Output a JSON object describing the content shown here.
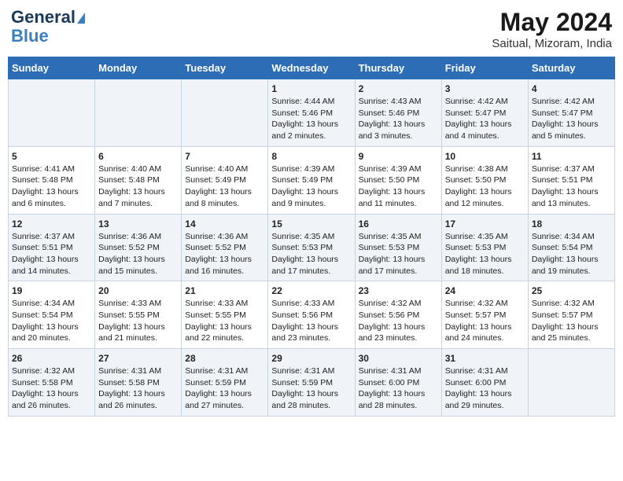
{
  "logo": {
    "line1": "General",
    "line2": "Blue"
  },
  "title": "May 2024",
  "subtitle": "Saitual, Mizoram, India",
  "days_of_week": [
    "Sunday",
    "Monday",
    "Tuesday",
    "Wednesday",
    "Thursday",
    "Friday",
    "Saturday"
  ],
  "weeks": [
    [
      {
        "num": "",
        "detail": ""
      },
      {
        "num": "",
        "detail": ""
      },
      {
        "num": "",
        "detail": ""
      },
      {
        "num": "1",
        "detail": "Sunrise: 4:44 AM\nSunset: 5:46 PM\nDaylight: 13 hours\nand 2 minutes."
      },
      {
        "num": "2",
        "detail": "Sunrise: 4:43 AM\nSunset: 5:46 PM\nDaylight: 13 hours\nand 3 minutes."
      },
      {
        "num": "3",
        "detail": "Sunrise: 4:42 AM\nSunset: 5:47 PM\nDaylight: 13 hours\nand 4 minutes."
      },
      {
        "num": "4",
        "detail": "Sunrise: 4:42 AM\nSunset: 5:47 PM\nDaylight: 13 hours\nand 5 minutes."
      }
    ],
    [
      {
        "num": "5",
        "detail": "Sunrise: 4:41 AM\nSunset: 5:48 PM\nDaylight: 13 hours\nand 6 minutes."
      },
      {
        "num": "6",
        "detail": "Sunrise: 4:40 AM\nSunset: 5:48 PM\nDaylight: 13 hours\nand 7 minutes."
      },
      {
        "num": "7",
        "detail": "Sunrise: 4:40 AM\nSunset: 5:49 PM\nDaylight: 13 hours\nand 8 minutes."
      },
      {
        "num": "8",
        "detail": "Sunrise: 4:39 AM\nSunset: 5:49 PM\nDaylight: 13 hours\nand 9 minutes."
      },
      {
        "num": "9",
        "detail": "Sunrise: 4:39 AM\nSunset: 5:50 PM\nDaylight: 13 hours\nand 11 minutes."
      },
      {
        "num": "10",
        "detail": "Sunrise: 4:38 AM\nSunset: 5:50 PM\nDaylight: 13 hours\nand 12 minutes."
      },
      {
        "num": "11",
        "detail": "Sunrise: 4:37 AM\nSunset: 5:51 PM\nDaylight: 13 hours\nand 13 minutes."
      }
    ],
    [
      {
        "num": "12",
        "detail": "Sunrise: 4:37 AM\nSunset: 5:51 PM\nDaylight: 13 hours\nand 14 minutes."
      },
      {
        "num": "13",
        "detail": "Sunrise: 4:36 AM\nSunset: 5:52 PM\nDaylight: 13 hours\nand 15 minutes."
      },
      {
        "num": "14",
        "detail": "Sunrise: 4:36 AM\nSunset: 5:52 PM\nDaylight: 13 hours\nand 16 minutes."
      },
      {
        "num": "15",
        "detail": "Sunrise: 4:35 AM\nSunset: 5:53 PM\nDaylight: 13 hours\nand 17 minutes."
      },
      {
        "num": "16",
        "detail": "Sunrise: 4:35 AM\nSunset: 5:53 PM\nDaylight: 13 hours\nand 17 minutes."
      },
      {
        "num": "17",
        "detail": "Sunrise: 4:35 AM\nSunset: 5:53 PM\nDaylight: 13 hours\nand 18 minutes."
      },
      {
        "num": "18",
        "detail": "Sunrise: 4:34 AM\nSunset: 5:54 PM\nDaylight: 13 hours\nand 19 minutes."
      }
    ],
    [
      {
        "num": "19",
        "detail": "Sunrise: 4:34 AM\nSunset: 5:54 PM\nDaylight: 13 hours\nand 20 minutes."
      },
      {
        "num": "20",
        "detail": "Sunrise: 4:33 AM\nSunset: 5:55 PM\nDaylight: 13 hours\nand 21 minutes."
      },
      {
        "num": "21",
        "detail": "Sunrise: 4:33 AM\nSunset: 5:55 PM\nDaylight: 13 hours\nand 22 minutes."
      },
      {
        "num": "22",
        "detail": "Sunrise: 4:33 AM\nSunset: 5:56 PM\nDaylight: 13 hours\nand 23 minutes."
      },
      {
        "num": "23",
        "detail": "Sunrise: 4:32 AM\nSunset: 5:56 PM\nDaylight: 13 hours\nand 23 minutes."
      },
      {
        "num": "24",
        "detail": "Sunrise: 4:32 AM\nSunset: 5:57 PM\nDaylight: 13 hours\nand 24 minutes."
      },
      {
        "num": "25",
        "detail": "Sunrise: 4:32 AM\nSunset: 5:57 PM\nDaylight: 13 hours\nand 25 minutes."
      }
    ],
    [
      {
        "num": "26",
        "detail": "Sunrise: 4:32 AM\nSunset: 5:58 PM\nDaylight: 13 hours\nand 26 minutes."
      },
      {
        "num": "27",
        "detail": "Sunrise: 4:31 AM\nSunset: 5:58 PM\nDaylight: 13 hours\nand 26 minutes."
      },
      {
        "num": "28",
        "detail": "Sunrise: 4:31 AM\nSunset: 5:59 PM\nDaylight: 13 hours\nand 27 minutes."
      },
      {
        "num": "29",
        "detail": "Sunrise: 4:31 AM\nSunset: 5:59 PM\nDaylight: 13 hours\nand 28 minutes."
      },
      {
        "num": "30",
        "detail": "Sunrise: 4:31 AM\nSunset: 6:00 PM\nDaylight: 13 hours\nand 28 minutes."
      },
      {
        "num": "31",
        "detail": "Sunrise: 4:31 AM\nSunset: 6:00 PM\nDaylight: 13 hours\nand 29 minutes."
      },
      {
        "num": "",
        "detail": ""
      }
    ]
  ]
}
